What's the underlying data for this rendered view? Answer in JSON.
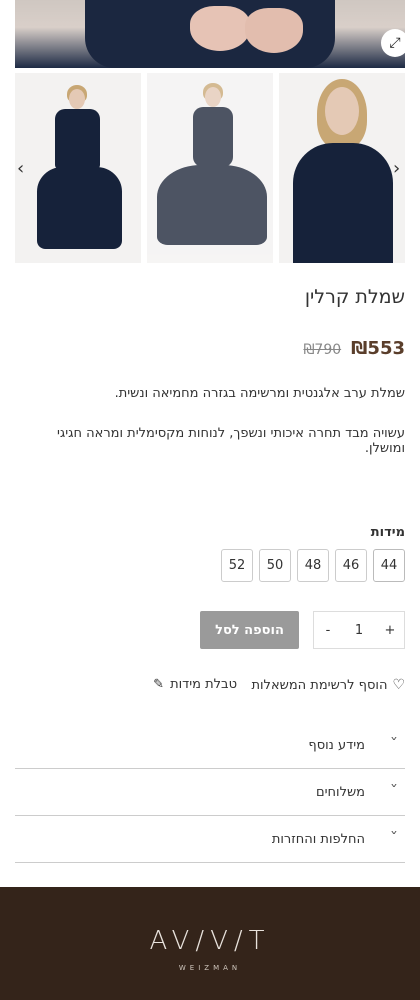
{
  "product": {
    "title": "שמלת קרלין",
    "price_old": "₪790",
    "price_new": "₪553",
    "description": [
      "שמלת ערב אלגנטית ומרשימה בגזרה מחמיאה ונשית.",
      "עשויה מבד תחרה איכותי ונשפך, לנוחות מקסימלית ומראה חגיגי ומושלן."
    ]
  },
  "gallery": {
    "expand_icon": "expand-icon",
    "prev_icon": "chevron-left-icon",
    "next_icon": "chevron-right-icon"
  },
  "sizes": {
    "label": "מידות",
    "options": [
      "44",
      "46",
      "48",
      "50",
      "52"
    ]
  },
  "cart": {
    "minus": "-",
    "quantity": "1",
    "plus": "+",
    "add_label": "הוספה לסל"
  },
  "links": {
    "wishlist": "הוסף לרשימת המשאלות",
    "size_chart": "טבלת מידות"
  },
  "accordion": [
    {
      "label": "מידע נוסף"
    },
    {
      "label": "משלוחים"
    },
    {
      "label": "החלפות והחזרות"
    }
  ],
  "footer": {
    "logo": "AV/V/T",
    "logo_sub": "WEIZMAN",
    "background": "#34241a"
  },
  "colors": {
    "price": "#5a3e2b",
    "button": "#9a9a9a"
  }
}
